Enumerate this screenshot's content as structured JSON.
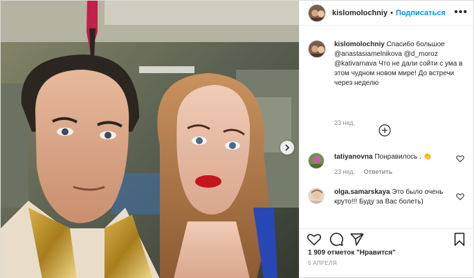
{
  "header": {
    "username": "kislomolochniy",
    "separator": "•",
    "follow_label": "Подписаться",
    "more_label": "•••"
  },
  "caption": {
    "username": "kislomolochniy",
    "text_1": "Спасибо большое",
    "mention_1": "@anastasiamelnikova",
    "mention_2": "@d_moroz",
    "mention_3": "@kativarnava",
    "text_2": "Что не дали сойти с ума в этом чудном новом мире! До встречи через неделю",
    "time": "23 нед."
  },
  "comments": [
    {
      "username": "tatiyanovna",
      "text": "Понравилось .",
      "emoji": "👏",
      "time": "23 нед.",
      "reply_label": "Ответить"
    },
    {
      "username": "olga.samarskaya",
      "text": "Это было очень круто!!! Буду за Вас болеть)",
      "time": "",
      "reply_label": ""
    }
  ],
  "likes": {
    "count": "1 909",
    "text": "отметок \"Нравится\""
  },
  "date": "5 АПРЕЛЯ",
  "colors": {
    "link": "#0095f6",
    "muted": "#8e8e8e",
    "border": "#efefef"
  },
  "icons": {
    "like": "heart-icon",
    "comment": "comment-icon",
    "share": "paper-plane-icon",
    "save": "bookmark-icon",
    "load_more": "plus-circle-icon",
    "next": "chevron-right-icon"
  }
}
